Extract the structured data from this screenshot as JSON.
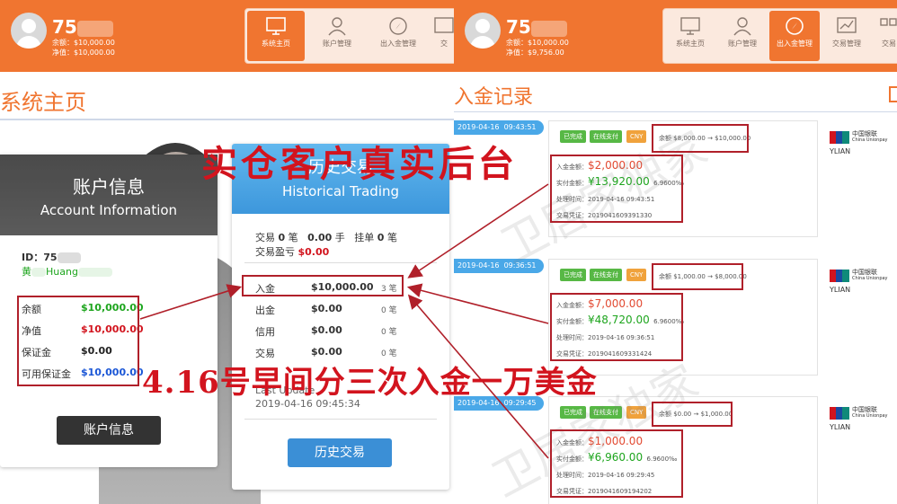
{
  "left": {
    "header": {
      "username": "75",
      "balance_line": "余额：$10,000.00",
      "equity_line": "净值：$10,000.00",
      "nav": [
        "系统主页",
        "账户管理",
        "出入金管理",
        "交"
      ]
    },
    "page_title": "系统主页",
    "account_card": {
      "title_cn": "账户信息",
      "title_en": "Account Information",
      "id_label": "ID：75",
      "name": "黄",
      "name_suffix": "Huang",
      "rows": [
        {
          "label": "余额",
          "value": "$10,000.00",
          "color": "#1ea51e"
        },
        {
          "label": "净值",
          "value": "$10,000.00",
          "color": "#d2141e"
        },
        {
          "label": "保证金",
          "value": "$0.00",
          "color": "#222222"
        },
        {
          "label": "可用保证金",
          "value": "$10,000.00",
          "color": "#1a56d6"
        }
      ],
      "button": "账户信息"
    },
    "history_card": {
      "title_cn": "历史交易",
      "title_en": "Historical Trading",
      "summary": {
        "trades_label": "交易",
        "trades_value": "0",
        "trades_unit": "笔",
        "lots_value": "0.00",
        "lots_unit": "手",
        "pending_label": "挂单",
        "pending_value": "0",
        "pending_unit": "笔",
        "pnl_label": "交易盈亏",
        "pnl_value": "$0.00"
      },
      "rows": [
        {
          "label": "入金",
          "value": "$10,000.00",
          "count": "3 笔"
        },
        {
          "label": "出金",
          "value": "$0.00",
          "count": "0 笔"
        },
        {
          "label": "信用",
          "value": "$0.00",
          "count": "0 笔"
        },
        {
          "label": "交易",
          "value": "$0.00",
          "count": "0 笔"
        }
      ],
      "last_update_label": "Last Update",
      "last_update": "2019-04-16 09:45:34",
      "button": "历史交易"
    }
  },
  "right": {
    "header": {
      "username": "75",
      "balance_line": "余额：$10,000.00",
      "equity_line": "净值：$9,756.00",
      "nav": [
        "系统主页",
        "账户管理",
        "出入金管理",
        "交易管理",
        "交易"
      ]
    },
    "page_title": "入金记录",
    "records": [
      {
        "date": "2019-04-16",
        "time": "09:43:51",
        "badges": [
          "已完成",
          "在线支付",
          "CNY"
        ],
        "balance_change": "余额 $8,000.00 → $10,000.00",
        "deposit_label": "入金金额：",
        "deposit": "$2,000.00",
        "paid_label": "实付金额：",
        "paid": "¥13,920.00",
        "rate": "6.9600‰",
        "process_time": "处理时间：2019-04-16 09:43:51",
        "voucher": "交易凭证：2019041609391330",
        "bank_name": "中国银联",
        "bank_en": "China Unionpay",
        "channel": "YLIAN"
      },
      {
        "date": "2019-04-16",
        "time": "09:36:51",
        "badges": [
          "已完成",
          "在线支付",
          "CNY"
        ],
        "balance_change": "余额 $1,000.00 → $8,000.00",
        "deposit_label": "入金金额：",
        "deposit": "$7,000.00",
        "paid_label": "实付金额：",
        "paid": "¥48,720.00",
        "rate": "6.9600‰",
        "process_time": "处理时间：2019-04-16 09:36:51",
        "voucher": "交易凭证：2019041609331424",
        "bank_name": "中国银联",
        "bank_en": "China Unionpay",
        "channel": "YLIAN"
      },
      {
        "date": "2019-04-16",
        "time": "09:29:45",
        "badges": [
          "已完成",
          "在线支付",
          "CNY"
        ],
        "balance_change": "余额 $0.00 → $1,000.00",
        "deposit_label": "入金金额：",
        "deposit": "$1,000.00",
        "paid_label": "实付金额：",
        "paid": "¥6,960.00",
        "rate": "6.9600‰",
        "process_time": "处理时间：2019-04-16 09:29:45",
        "voucher": "交易凭证：2019041609194202",
        "bank_name": "中国银联",
        "bank_en": "China Unionpay",
        "channel": "YLIAN"
      }
    ]
  },
  "annotations": {
    "headline": "实仓客户真实后台",
    "note": "4.16号早间分三次入金一万美金",
    "watermark": "卫居家独家"
  },
  "colors": {
    "brand_orange": "#f07530",
    "annotation_red": "#d2141e",
    "button_blue": "#3b8fd6",
    "date_blue": "#4aa8e8"
  }
}
